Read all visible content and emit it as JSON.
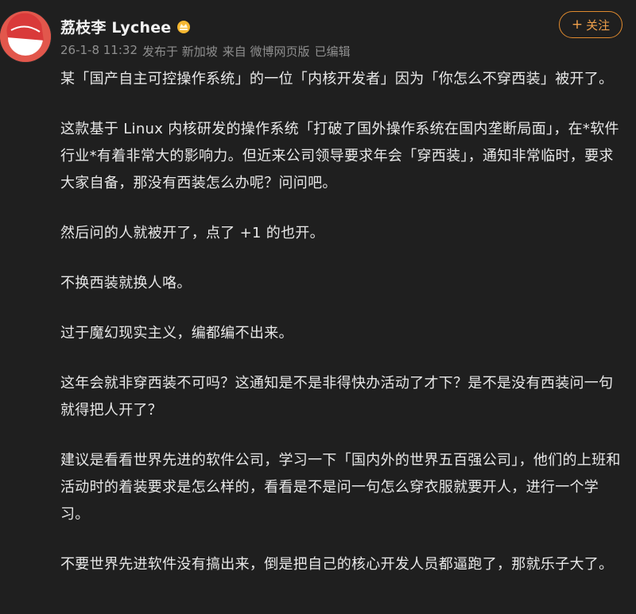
{
  "header": {
    "username": "荔枝李 Lychee",
    "verified_icon": "verified-badge-icon",
    "meta": {
      "time": "26-1-8 11:32",
      "location": "发布于 新加坡",
      "source": "来自 微博网页版",
      "edited": "已编辑"
    },
    "follow_button": {
      "icon": "+",
      "label": "关注"
    }
  },
  "colors": {
    "background": "#1f1f1f",
    "text": "#e8e8e8",
    "meta": "#8f8f8f",
    "accent": "#f0a04b",
    "avatar_red": "#e2574c"
  },
  "content": {
    "paragraphs": [
      "某「国产自主可控操作系统」的一位「内核开发者」因为「你怎么不穿西装」被开了。",
      "这款基于 Linux 内核研发的操作系统「打破了国外操作系统在国内垄断局面」，在*软件行业*有着非常大的影响力。但近来公司领导要求年会「穿西装」，通知非常临时，要求大家自备，那没有西装怎么办呢？问问吧。",
      "然后问的人就被开了，点了 +1 的也开。",
      "不换西装就换人咯。",
      "过于魔幻现实主义，编都编不出来。",
      "这年会就非穿西装不可吗？这通知是不是非得快办活动了才下？是不是没有西装问一句就得把人开了？",
      "建议是看看世界先进的软件公司，学习一下「国内外的世界五百强公司」，他们的上班和活动时的着装要求是怎么样的，看看是不是问一句怎么穿衣服就要开人，进行一个学习。",
      "不要世界先进软件没有搞出来，倒是把自己的核心开发人员都逼跑了，那就乐子大了。"
    ]
  }
}
